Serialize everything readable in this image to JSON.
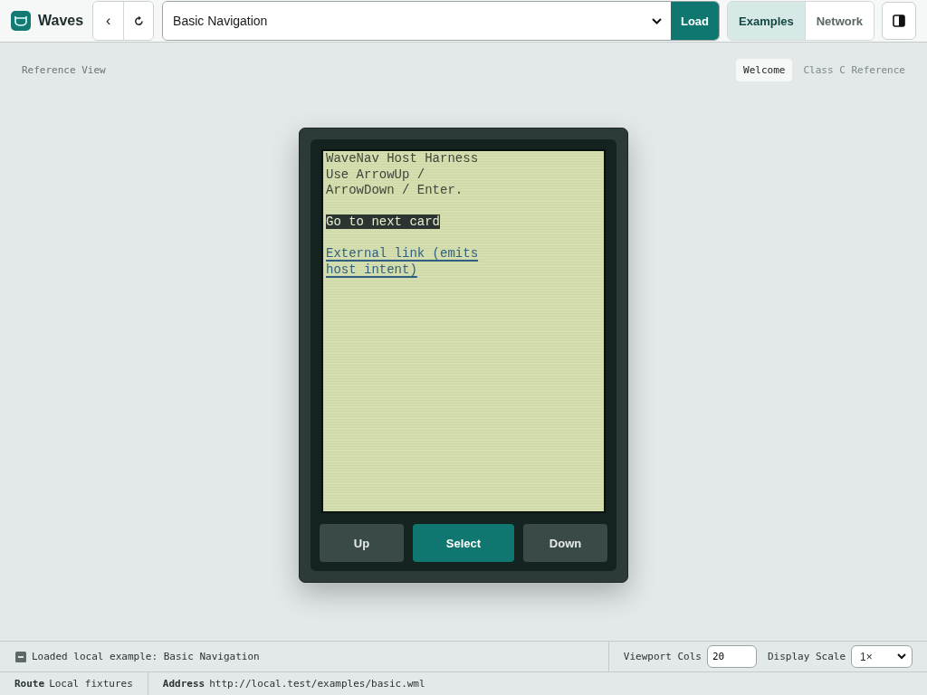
{
  "app": {
    "name": "Waves"
  },
  "nav": {
    "back": "‹"
  },
  "example_select": {
    "value": "Basic Navigation"
  },
  "load_button": "Load",
  "tabs": [
    {
      "label": "Examples",
      "selected": true
    },
    {
      "label": "Network",
      "selected": false
    }
  ],
  "view": {
    "title": "Reference View",
    "cards": [
      {
        "label": "Welcome",
        "selected": true
      },
      {
        "label": "Class C Reference",
        "selected": false
      }
    ]
  },
  "device": {
    "lines": [
      {
        "kind": "text",
        "text": "WaveNav Host Harness"
      },
      {
        "kind": "text",
        "text": "Use ArrowUp / ArrowDown / Enter."
      },
      {
        "kind": "action",
        "text": "Go to next card",
        "focused": true
      },
      {
        "kind": "link",
        "text": "External link (emits host intent)",
        "focused": false
      }
    ],
    "keys": [
      {
        "label": "Up",
        "primary": false
      },
      {
        "label": "Select",
        "primary": true
      },
      {
        "label": "Down",
        "primary": false
      }
    ]
  },
  "status": {
    "message": "Loaded local example: Basic Navigation",
    "viewport_cols_label": "Viewport Cols",
    "viewport_cols": "20",
    "display_scale_label": "Display Scale",
    "display_scale": "1×"
  },
  "footer": {
    "route_label": "Route",
    "route": "Local fixtures",
    "address_label": "Address",
    "address": "http://local.test/examples/basic.wml"
  }
}
